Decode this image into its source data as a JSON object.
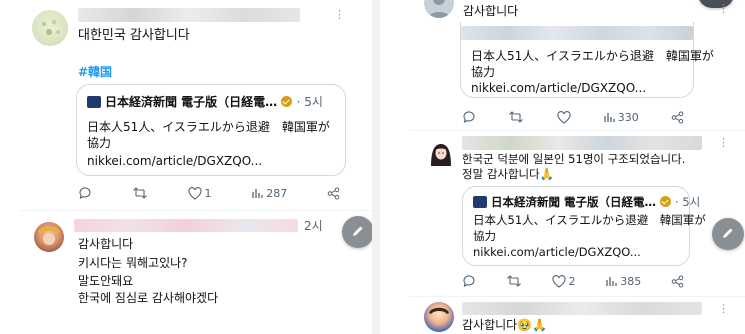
{
  "left": {
    "post1": {
      "text": "대한민국 감사합니다",
      "hashtag": "#韓国",
      "card": {
        "source": "日本経済新聞 電子版（日経電…",
        "time": "· 5시",
        "headline_line1": "日本人51人、イスラエルから退避　韓国軍が",
        "headline_line2": "協力",
        "url": "nikkei.com/article/DGXZQO..."
      },
      "likes": "1",
      "views": "287"
    },
    "post2": {
      "time": "2시",
      "lines": [
        "감사합니다",
        "키시다는 뭐해고있나?",
        "말도안돼요",
        "한국에 짐심로 감사해야겠다"
      ]
    }
  },
  "right": {
    "post1": {
      "text": "감사합니다",
      "quote": {
        "headline_line1": "日本人51人、イスラエルから退避　韓国軍が",
        "headline_line2": "協力",
        "url": "nikkei.com/article/DGXZQO..."
      },
      "views": "330"
    },
    "post2": {
      "text_line1": "한국군 덕분에 일본인 51명이 구조되었습니다.",
      "text_line2": "정말 감사합니다🙏",
      "card": {
        "source": "日本経済新聞 電子版（日経電…",
        "time": "· 5시",
        "headline_line1": "日本人51人、イスラエルから退避　韓国軍が",
        "headline_line2": "協力",
        "url": "nikkei.com/article/DGXZQO..."
      },
      "likes": "2",
      "views": "385"
    },
    "post3": {
      "text": "감사합니다🥹🙏"
    }
  },
  "icons": [
    "reply-icon",
    "retweet-icon",
    "heart-icon",
    "views-icon",
    "share-icon",
    "more-icon",
    "compose-icon"
  ]
}
